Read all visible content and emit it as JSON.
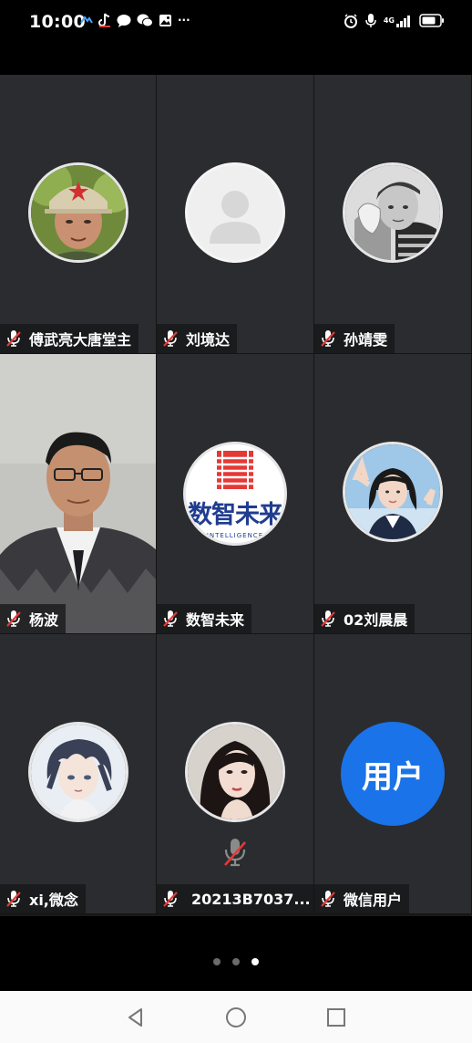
{
  "status_bar": {
    "time": "10:00",
    "network": "4G",
    "more": "···"
  },
  "tiles": [
    {
      "name": "傅武亮大唐堂主",
      "avatar": "photo-man-cap"
    },
    {
      "name": "刘境达",
      "avatar": "default-avatar"
    },
    {
      "name": "孙靖雯",
      "avatar": "photo-bw-child"
    },
    {
      "name": "杨波",
      "avatar": "live-video"
    },
    {
      "name": "数智未来",
      "avatar": "logo",
      "logo_text": "数智未来",
      "logo_sub": "INTELLIGENCE"
    },
    {
      "name": "02刘晨晨",
      "avatar": "photo-girl"
    },
    {
      "name": "xi,微念",
      "avatar": "anime-boy"
    },
    {
      "name": "20213B7037...",
      "avatar": "photo-woman"
    },
    {
      "name": "微信用户",
      "avatar": "text-avatar",
      "avatar_text": "用户"
    }
  ],
  "pagination": {
    "count": 3,
    "active": 3
  },
  "colors": {
    "tile_bg": "#2b2c2f",
    "accent_blue": "#1a73e8",
    "mic_muted_red": "#e53935"
  }
}
